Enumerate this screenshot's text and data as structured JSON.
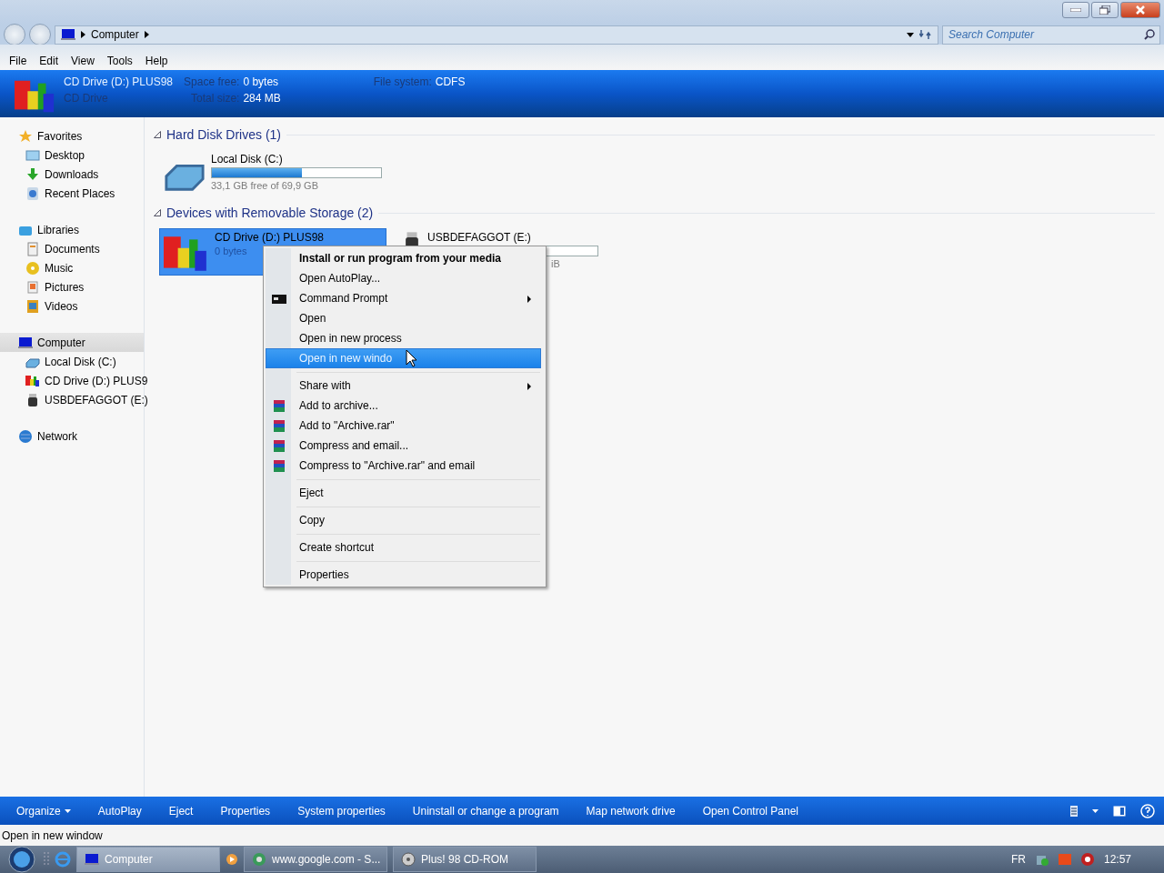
{
  "address": {
    "crumbs": [
      "Computer"
    ],
    "search_placeholder": "Search Computer"
  },
  "menubar": [
    "File",
    "Edit",
    "View",
    "Tools",
    "Help"
  ],
  "details": {
    "name": "CD Drive (D:) PLUS98",
    "type": "CD Drive",
    "fields": [
      {
        "label": "Space free:",
        "value": "0 bytes"
      },
      {
        "label": "Total size:",
        "value": "284 MB"
      },
      {
        "label": "File system:",
        "value": "CDFS"
      }
    ]
  },
  "sidebar": [
    {
      "label": "Favorites",
      "selected": false,
      "children": [
        {
          "label": "Desktop",
          "selected": false
        },
        {
          "label": "Downloads",
          "selected": false
        },
        {
          "label": "Recent Places",
          "selected": false
        }
      ]
    },
    {
      "label": "Libraries",
      "selected": false,
      "children": [
        {
          "label": "Documents",
          "selected": false
        },
        {
          "label": "Music",
          "selected": false
        },
        {
          "label": "Pictures",
          "selected": false
        },
        {
          "label": "Videos",
          "selected": false
        }
      ]
    },
    {
      "label": "Computer",
      "selected": true,
      "children": [
        {
          "label": "Local Disk (C:)",
          "selected": false
        },
        {
          "label": "CD Drive (D:) PLUS9",
          "selected": false
        },
        {
          "label": "USBDEFAGGOT (E:)",
          "selected": false
        }
      ]
    },
    {
      "label": "Network",
      "selected": false
    }
  ],
  "groups": [
    {
      "title": "Hard Disk Drives (1)",
      "expanded": true,
      "drives": [
        {
          "name": "Local Disk (C:)",
          "selected": false,
          "level": 0.53,
          "info": "33,1 GB free of 69,9 GB"
        }
      ]
    },
    {
      "title": "Devices with Removable Storage (2)",
      "expanded": true,
      "drives": [
        {
          "name": "CD Drive (D:) PLUS98",
          "selected": true,
          "info": "0 bytes"
        },
        {
          "name": "USBDEFAGGOT (E:)",
          "selected": false,
          "info": "iB"
        }
      ]
    }
  ],
  "context_menu": [
    {
      "label": "Install or run program from your media",
      "kind": "item",
      "bold": true,
      "submenu": false,
      "selected": false
    },
    {
      "label": "Open AutoPlay...",
      "kind": "item",
      "bold": false,
      "submenu": false,
      "selected": false
    },
    {
      "label": "Command Prompt",
      "kind": "command",
      "bold": false,
      "submenu": true,
      "selected": false
    },
    {
      "label": "Open",
      "kind": "item",
      "bold": false,
      "submenu": false,
      "selected": false
    },
    {
      "label": "Open in new process",
      "kind": "item",
      "bold": false,
      "submenu": false,
      "selected": false
    },
    {
      "label": "Open in new windo",
      "kind": "item",
      "bold": false,
      "submenu": false,
      "selected": true
    },
    {
      "kind": "separator"
    },
    {
      "label": "Share with",
      "kind": "item",
      "bold": false,
      "submenu": true,
      "selected": false
    },
    {
      "label": "Add to archive...",
      "kind": "archive",
      "bold": false,
      "submenu": false,
      "selected": false
    },
    {
      "label": "Add to \"Archive.rar\"",
      "kind": "archive",
      "bold": false,
      "submenu": false,
      "selected": false
    },
    {
      "label": "Compress and email...",
      "kind": "archive",
      "bold": false,
      "submenu": false,
      "selected": false
    },
    {
      "label": "Compress to \"Archive.rar\" and email",
      "kind": "archive",
      "bold": false,
      "submenu": false,
      "selected": false
    },
    {
      "kind": "separator"
    },
    {
      "label": "Eject",
      "kind": "item",
      "bold": false,
      "submenu": false,
      "selected": false
    },
    {
      "kind": "separator"
    },
    {
      "label": "Copy",
      "kind": "item",
      "bold": false,
      "submenu": false,
      "selected": false
    },
    {
      "kind": "separator"
    },
    {
      "label": "Create shortcut",
      "kind": "item",
      "bold": false,
      "submenu": false,
      "selected": false
    },
    {
      "kind": "separator"
    },
    {
      "label": "Properties",
      "kind": "item",
      "bold": false,
      "submenu": false,
      "selected": false
    }
  ],
  "commandbar": [
    {
      "label": "Organize",
      "dropdown": true
    },
    {
      "label": "AutoPlay",
      "dropdown": false
    },
    {
      "label": "Eject",
      "dropdown": false
    },
    {
      "label": "Properties",
      "dropdown": false
    },
    {
      "label": "System properties",
      "dropdown": false
    },
    {
      "label": "Uninstall or change a program",
      "dropdown": false
    },
    {
      "label": "Map network drive",
      "dropdown": false
    },
    {
      "label": "Open Control Panel",
      "dropdown": false
    }
  ],
  "status_bar": "Open in new window",
  "taskbar": {
    "buttons": [
      {
        "label": "Computer",
        "selected": true
      },
      {
        "label": "www.google.com - S...",
        "selected": false
      },
      {
        "label": "Plus! 98 CD-ROM",
        "selected": false
      }
    ],
    "language": "FR",
    "clock": "12:57"
  }
}
